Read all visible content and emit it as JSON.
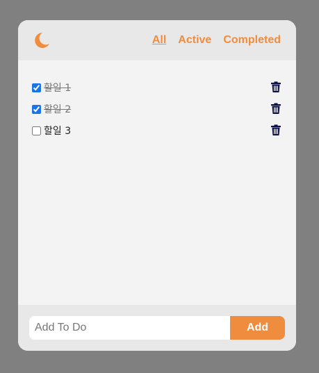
{
  "header": {
    "theme_icon": "moon-icon",
    "filters": [
      {
        "label": "All",
        "selected": true
      },
      {
        "label": "Active",
        "selected": false
      },
      {
        "label": "Completed",
        "selected": false
      }
    ]
  },
  "todos": [
    {
      "text": "할일 1",
      "done": true
    },
    {
      "text": "할일 2",
      "done": true
    },
    {
      "text": "할일 3",
      "done": false
    }
  ],
  "footer": {
    "input_placeholder": "Add To Do",
    "add_label": "Add"
  },
  "colors": {
    "accent": "#f08c3e",
    "trash": "#0a1045",
    "backdrop": "#808080"
  }
}
